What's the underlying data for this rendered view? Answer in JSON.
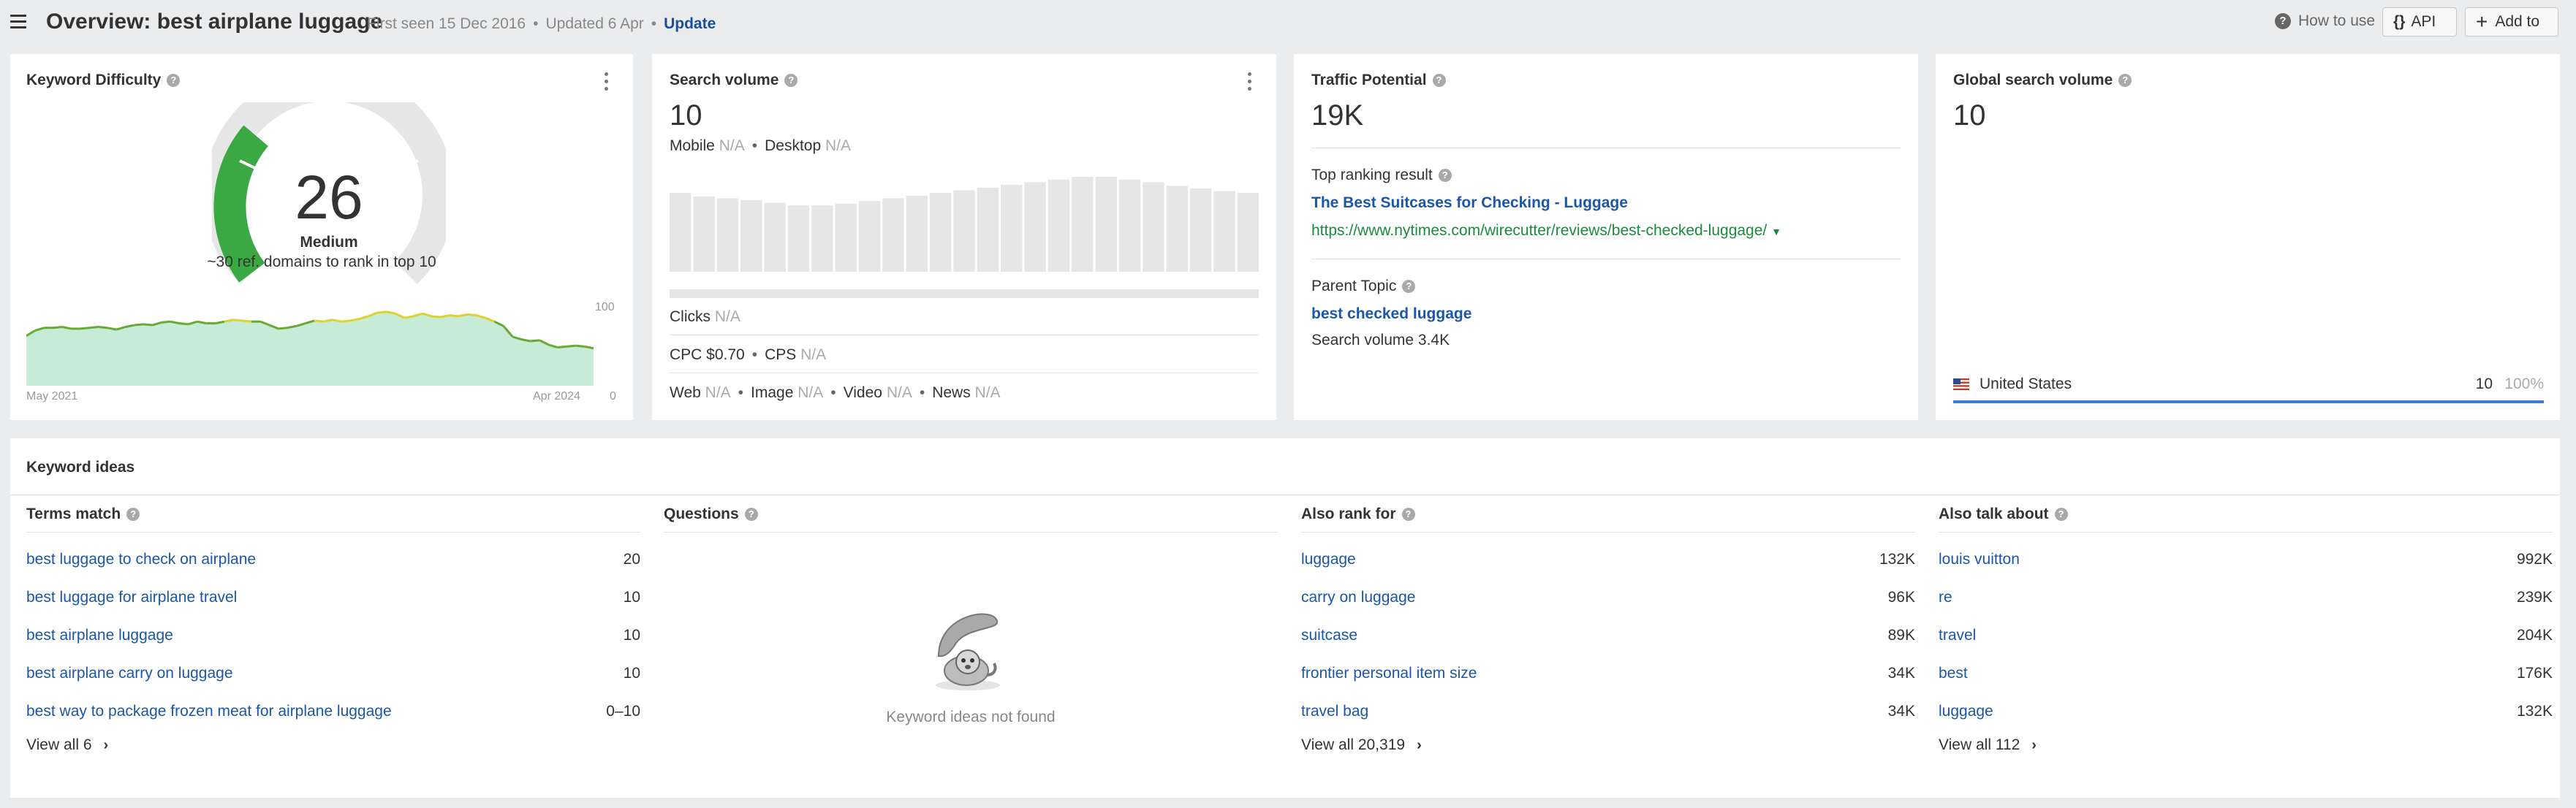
{
  "header": {
    "title": "Overview: best airplane luggage",
    "first_seen": "First seen 15 Dec 2016",
    "updated": "Updated 6 Apr",
    "update_link": "Update",
    "how_to_use": "How to use",
    "api_label": "API",
    "add_to_label": "Add to"
  },
  "keyword_difficulty": {
    "title": "Keyword Difficulty",
    "value": "26",
    "level": "Medium",
    "subtitle": "~30 ref. domains to rank in top 10",
    "chart_start": "May 2021",
    "chart_end": "Apr 2024",
    "y_max": "100",
    "y_min": "0"
  },
  "search_volume": {
    "title": "Search volume",
    "value": "10",
    "mobile_label": "Mobile",
    "mobile_value": "N/A",
    "desktop_label": "Desktop",
    "desktop_value": "N/A",
    "clicks_label": "Clicks",
    "clicks_value": "N/A",
    "cpc_label": "CPC $0.70",
    "cps_label": "CPS",
    "cps_value": "N/A",
    "web_label": "Web",
    "web_value": "N/A",
    "image_label": "Image",
    "image_value": "N/A",
    "video_label": "Video",
    "video_value": "N/A",
    "news_label": "News",
    "news_value": "N/A"
  },
  "traffic_potential": {
    "title": "Traffic Potential",
    "value": "19K",
    "top_ranking_label": "Top ranking result",
    "top_result_title": "The Best Suitcases for Checking - Luggage",
    "top_result_url": "https://www.nytimes.com/wirecutter/reviews/best-checked-luggage/",
    "parent_topic_label": "Parent Topic",
    "parent_topic": "best checked luggage",
    "parent_volume": "Search volume 3.4K"
  },
  "global_volume": {
    "title": "Global search volume",
    "value": "10",
    "country": "United States",
    "country_volume": "10",
    "country_share": "100%"
  },
  "keyword_ideas": {
    "title": "Keyword ideas",
    "terms_match": {
      "title": "Terms match",
      "rows": [
        {
          "keyword": "best luggage to check on airplane",
          "volume": "20"
        },
        {
          "keyword": "best luggage for airplane travel",
          "volume": "10"
        },
        {
          "keyword": "best airplane luggage",
          "volume": "10"
        },
        {
          "keyword": "best airplane carry on luggage",
          "volume": "10"
        },
        {
          "keyword": "best way to package frozen meat for airplane luggage",
          "volume": "0–10"
        }
      ],
      "view_all": "View all 6"
    },
    "questions": {
      "title": "Questions",
      "empty": "Keyword ideas not found"
    },
    "also_rank_for": {
      "title": "Also rank for",
      "rows": [
        {
          "keyword": "luggage",
          "volume": "132K"
        },
        {
          "keyword": "carry on luggage",
          "volume": "96K"
        },
        {
          "keyword": "suitcase",
          "volume": "89K"
        },
        {
          "keyword": "frontier personal item size",
          "volume": "34K"
        },
        {
          "keyword": "travel bag",
          "volume": "34K"
        }
      ],
      "view_all": "View all 20,319"
    },
    "also_talk_about": {
      "title": "Also talk about",
      "rows": [
        {
          "keyword": "louis vuitton",
          "volume": "992K"
        },
        {
          "keyword": "re",
          "volume": "239K"
        },
        {
          "keyword": "travel",
          "volume": "204K"
        },
        {
          "keyword": "best",
          "volume": "176K"
        },
        {
          "keyword": "luggage",
          "volume": "132K"
        }
      ],
      "view_all": "View all 112"
    }
  },
  "colors": {
    "link": "#1b57a8",
    "url_green": "#1a8a3c",
    "gauge_green": "#3aa843",
    "gauge_bg": "#e6e6e6",
    "chart_line_green": "#6aa836",
    "chart_line_yellow": "#e0d12c",
    "chart_fill": "#c6ebd6"
  },
  "chart_data": {
    "type": "area",
    "x": [
      "May 2021",
      "Apr 2024"
    ],
    "values": [
      0.56,
      0.62,
      0.65,
      0.65,
      0.66,
      0.64,
      0.64,
      0.65,
      0.66,
      0.65,
      0.63,
      0.66,
      0.68,
      0.69,
      0.68,
      0.71,
      0.72,
      0.7,
      0.69,
      0.72,
      0.7,
      0.7,
      0.72,
      0.74,
      0.73,
      0.72,
      0.72,
      0.68,
      0.64,
      0.65,
      0.67,
      0.7,
      0.73,
      0.72,
      0.74,
      0.72,
      0.73,
      0.75,
      0.78,
      0.82,
      0.83,
      0.81,
      0.76,
      0.78,
      0.81,
      0.78,
      0.77,
      0.79,
      0.78,
      0.8,
      0.79,
      0.76,
      0.72,
      0.67,
      0.55,
      0.52,
      0.5,
      0.51,
      0.46,
      0.43,
      0.44,
      0.45,
      0.44,
      0.42
    ],
    "ylim": [
      0,
      100
    ],
    "xlabel": "",
    "ylabel": ""
  },
  "volume_bars": {
    "values": [
      0.88,
      0.84,
      0.82,
      0.8,
      0.77,
      0.74,
      0.74,
      0.76,
      0.79,
      0.82,
      0.85,
      0.88,
      0.91,
      0.94,
      0.97,
      1.0,
      1.03,
      1.06,
      1.06,
      1.03,
      1.0,
      0.96,
      0.93,
      0.9,
      0.88
    ]
  }
}
